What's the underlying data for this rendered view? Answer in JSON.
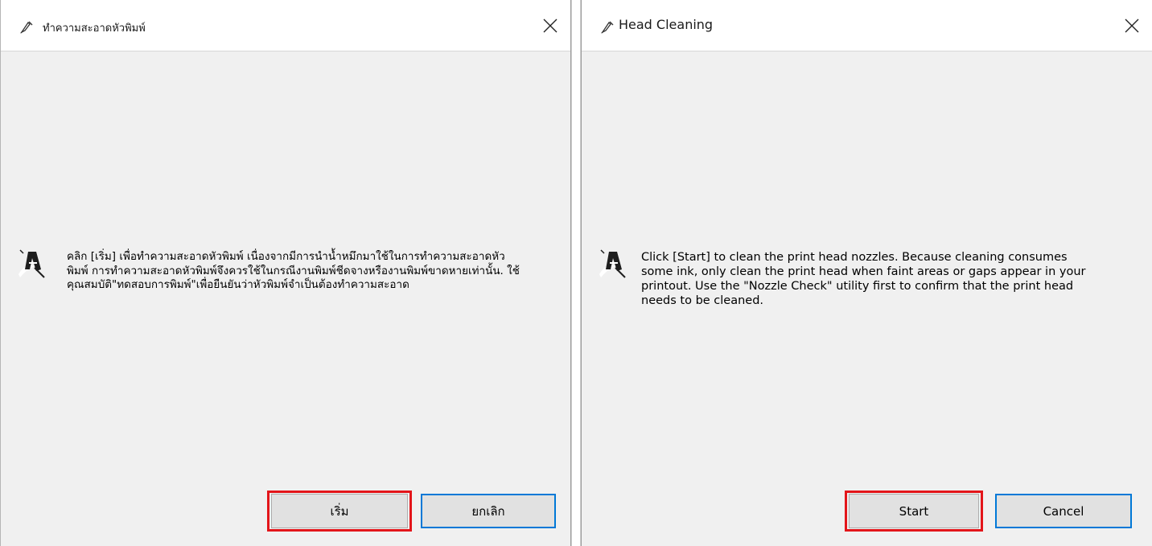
{
  "left_dialog": {
    "title": "ทำความสะอาดหัวพิมพ์",
    "message": "คลิก [เริ่ม] เพื่อทำความสะอาดหัวพิมพ์ เนื่องจากมีการนำน้ำหมึกมาใช้ในการทำความสะอาดหัวพิมพ์ การทำความสะอาดหัวพิมพ์จึงควรใช้ในกรณีงานพิมพ์ชีดจางหรืองานพิมพ์ขาดหายเท่านั้น. ใช้คุณสมบัติ\"ทดสอบการพิมพ์\"เพื่อยืนยันว่าหัวพิมพ์จำเป็นต้องทำความสะอาด",
    "start_label": "เริ่ม",
    "cancel_label": "ยกเลิก"
  },
  "right_dialog": {
    "title": "Head Cleaning",
    "message": "Click [Start] to clean the print head nozzles. Because cleaning consumes some ink, only clean the print head when faint areas or gaps appear in your printout. Use the \"Nozzle Check\" utility first to confirm that the print head needs to be cleaned.",
    "start_label": "Start",
    "cancel_label": "Cancel"
  },
  "colors": {
    "highlight": "#e3151a",
    "default_button_border": "#0078d7",
    "dialog_background": "#f0f0f0"
  },
  "icons": {
    "title": "print-head-nozzle-icon",
    "body": "print-head-nozzle-icon",
    "close": "close-icon"
  }
}
